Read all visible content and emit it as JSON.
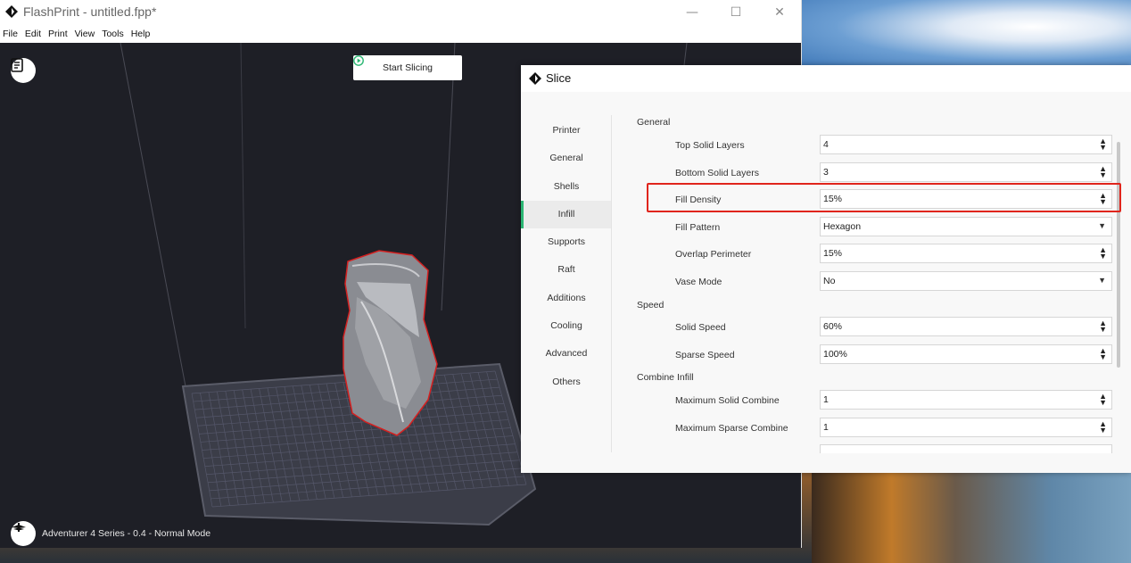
{
  "window": {
    "title": "FlashPrint - untitled.fpp*",
    "controls": {
      "minimize": "—",
      "maximize": "☐",
      "close": "✕"
    }
  },
  "menu": [
    "File",
    "Edit",
    "Print",
    "View",
    "Tools",
    "Help"
  ],
  "toolbar": {
    "start_slicing": "Start Slicing"
  },
  "status": {
    "printer": "Adventurer 4 Series - 0.4 - Normal Mode"
  },
  "dialog": {
    "title": "Slice",
    "sidebar": [
      "Printer",
      "General",
      "Shells",
      "Infill",
      "Supports",
      "Raft",
      "Additions",
      "Cooling",
      "Advanced",
      "Others"
    ],
    "active_tab": "Infill",
    "sections": {
      "general": "General",
      "speed": "Speed",
      "combine": "Combine Infill"
    },
    "fields": {
      "top_solid_layers": {
        "label": "Top Solid Layers",
        "value": "4"
      },
      "bottom_solid_layers": {
        "label": "Bottom Solid Layers",
        "value": "3"
      },
      "fill_density": {
        "label": "Fill Density",
        "value": "15%"
      },
      "fill_pattern": {
        "label": "Fill Pattern",
        "value": "Hexagon"
      },
      "overlap_perimeter": {
        "label": "Overlap Perimeter",
        "value": "15%"
      },
      "vase_mode": {
        "label": "Vase Mode",
        "value": "No"
      },
      "solid_speed": {
        "label": "Solid Speed",
        "value": "60%"
      },
      "sparse_speed": {
        "label": "Sparse Speed",
        "value": "100%"
      },
      "max_solid_combine": {
        "label": "Maximum Solid Combine",
        "value": "1"
      },
      "max_sparse_combine": {
        "label": "Maximum Sparse Combine",
        "value": "1"
      }
    }
  },
  "colors": {
    "accent": "#2bb673",
    "highlight": "#e0251c",
    "viewport": "#1e1f26",
    "model_outline": "#d42020"
  }
}
